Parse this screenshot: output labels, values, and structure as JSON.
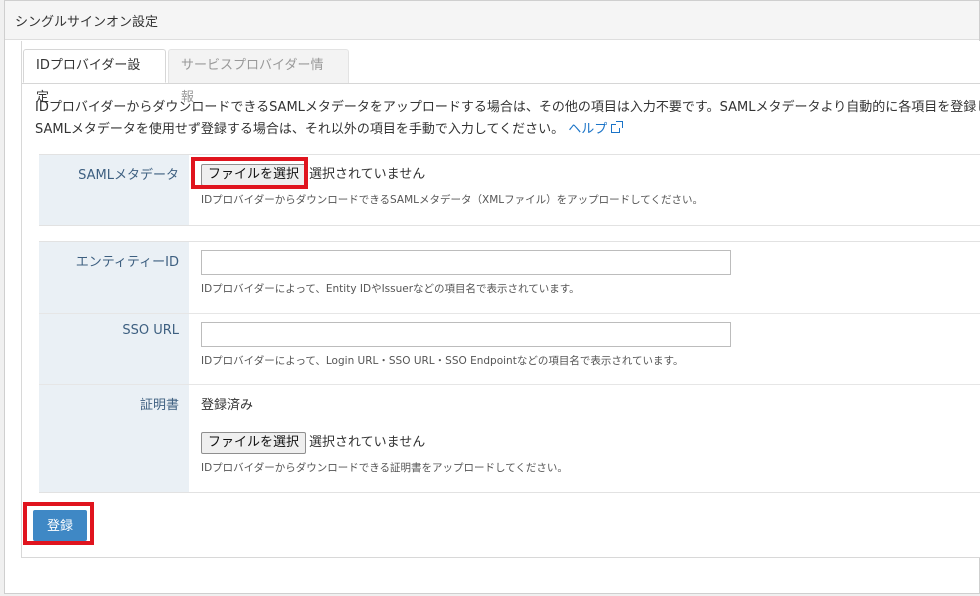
{
  "window": {
    "title": "シングルサインオン設定"
  },
  "tabs": [
    {
      "label": "IDプロバイダー設定",
      "active": true
    },
    {
      "label": "サービスプロバイダー情報",
      "active": false
    }
  ],
  "description": {
    "line1": "IDプロバイダーからダウンロードできるSAMLメタデータをアップロードする場合は、その他の項目は入力不要です。SAMLメタデータより自動的に各項目を登録します。",
    "line2": "SAMLメタデータを使用せず登録する場合は、それ以外の項目を手動で入力してください。",
    "help_link": "ヘルプ"
  },
  "saml_section": {
    "label": "SAMLメタデータ",
    "file_button": "ファイルを選択",
    "file_status": "選択されていません",
    "hint": "IDプロバイダーからダウンロードできるSAMLメタデータ（XMLファイル）をアップロードしてください。"
  },
  "manual_section": {
    "entity_id": {
      "label": "エンティティーID",
      "value": "",
      "hint": "IDプロバイダーによって、Entity IDやIssuerなどの項目名で表示されています。"
    },
    "sso_url": {
      "label": "SSO URL",
      "value": "",
      "hint": "IDプロバイダーによって、Login URL・SSO URL・SSO Endpointなどの項目名で表示されています。"
    },
    "certificate": {
      "label": "証明書",
      "status": "登録済み",
      "file_button": "ファイルを選択",
      "file_status": "選択されていません",
      "hint": "IDプロバイダーからダウンロードできる証明書をアップロードしてください。"
    }
  },
  "submit": {
    "label": "登録"
  },
  "colors": {
    "accent": "#3f88c5",
    "highlight": "#e0141e",
    "link": "#1a73c7",
    "label_bg": "#eaf0f5"
  }
}
